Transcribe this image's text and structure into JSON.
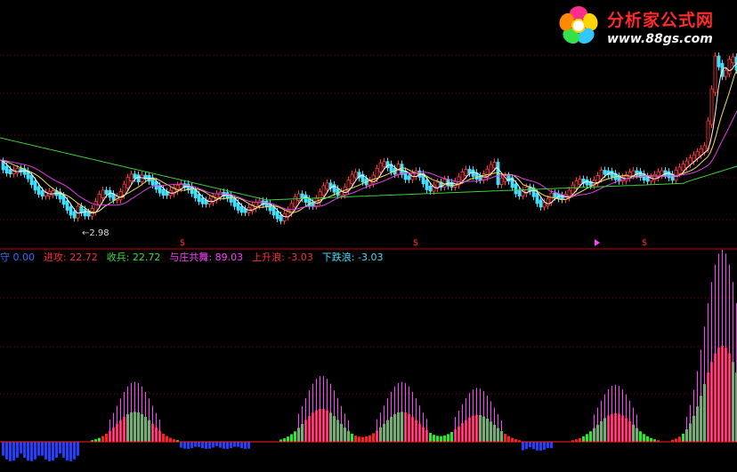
{
  "logo": {
    "title": "分析家公式网",
    "url": "www.88gs.com",
    "petal_colors": [
      "#ff2e8a",
      "#ffd400",
      "#32c8ff",
      "#36e04a",
      "#ff8a00"
    ]
  },
  "price_panel": {
    "low_marker_label": "2.98",
    "signal_glyph": "$",
    "ma_colors": {
      "short": "#f5f5f5",
      "mid": "#f0e060",
      "long": "#e040e0",
      "longest": "#3cd23c"
    },
    "candle_up_color": "#ff3c3c",
    "candle_down_color": "#40e0ff"
  },
  "indicator_legend": {
    "items": [
      {
        "label": "守 0.00",
        "color": "#3b6bff"
      },
      {
        "label": "进攻: 22.72",
        "color": "#ff3030"
      },
      {
        "label": "收兵: 22.72",
        "color": "#33e033"
      },
      {
        "label": "与庄共舞: 89.03",
        "color": "#ff40ff"
      },
      {
        "label": "上升浪: -3.03",
        "color": "#ff3030"
      },
      {
        "label": "下跌浪: -3.03",
        "color": "#40e0ff"
      }
    ]
  },
  "colors": {
    "background": "#000000",
    "grid": "#8b0000",
    "separator": "#c00000",
    "attack": "#ff2020",
    "retreat": "#22ee22",
    "dance": "#ff40ff",
    "guard": "#2040ff",
    "fall": "#40e0ff"
  }
}
